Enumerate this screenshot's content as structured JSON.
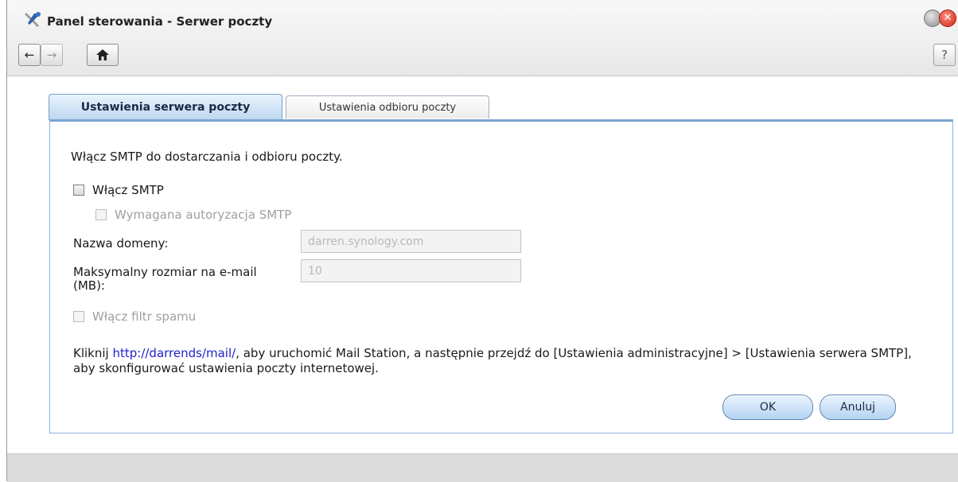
{
  "window": {
    "title": "Panel sterowania - Serwer poczty",
    "app_icon": "tools-icon",
    "close_glyph": "✕"
  },
  "toolbar": {
    "back_icon": "arrow-left-icon",
    "forward_icon": "arrow-right-icon",
    "home_icon": "home-icon",
    "back_glyph": "←",
    "forward_glyph": "→",
    "home_glyph": "⌂",
    "help_label": "?"
  },
  "tabs": [
    {
      "label": "Ustawienia serwera poczty",
      "active": true
    },
    {
      "label": "Ustawienia odbioru poczty",
      "active": false
    }
  ],
  "form": {
    "intro": "Włącz SMTP do dostarczania i odbioru poczty.",
    "enable_smtp": {
      "label": "Włącz SMTP",
      "checked": false
    },
    "smtp_auth": {
      "label": "Wymagana autoryzacja SMTP",
      "checked": false,
      "disabled": true
    },
    "domain": {
      "label": "Nazwa domeny:",
      "value": "darren.synology.com"
    },
    "max_size": {
      "label": "Maksymalny rozmiar na e-mail (MB):",
      "value": "10"
    },
    "spam_filter": {
      "label": "Włącz filtr spamu",
      "checked": false,
      "disabled": true
    },
    "info": {
      "prefix": "Kliknij ",
      "link": "http://darrends/mail/",
      "suffix": ", aby uruchomić Mail Station, a następnie przejdź do [Ustawienia administracyjne] > [Ustawienia serwera SMTP], aby skonfigurować ustawienia poczty internetowej."
    }
  },
  "buttons": {
    "ok": "OK",
    "cancel": "Anuluj"
  },
  "colors": {
    "accent": "#7aa5d2",
    "link": "#2222cc",
    "close": "#d0281a"
  }
}
